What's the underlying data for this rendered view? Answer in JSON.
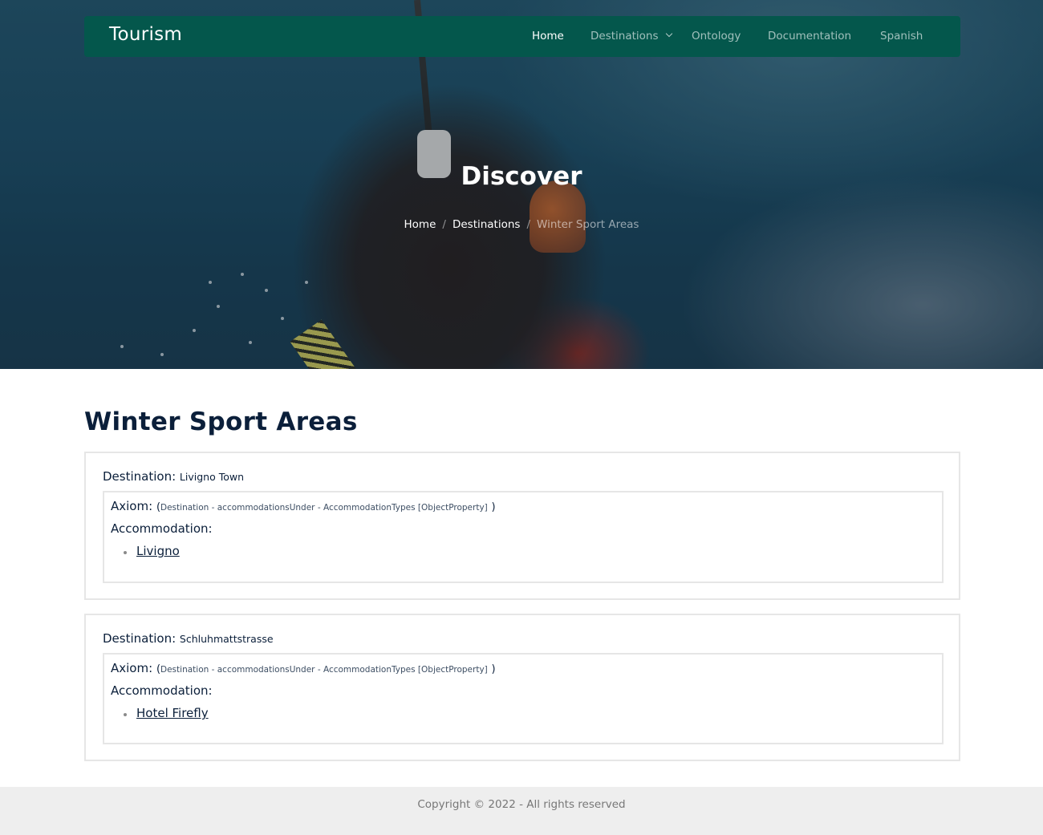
{
  "header": {
    "brand": "Tourism",
    "nav": [
      {
        "label": "Home"
      },
      {
        "label": "Destinations"
      },
      {
        "label": "Ontology"
      },
      {
        "label": "Documentation"
      },
      {
        "label": "Spanish"
      }
    ],
    "active": "Home",
    "background_color": "#04574c"
  },
  "hero": {
    "title": "Discover",
    "breadcrumb": [
      "Home",
      "Destinations",
      "Winter Sport Areas"
    ],
    "separator": "/"
  },
  "main": {
    "title": "Winter Sport Areas",
    "destinations": [
      {
        "label": "Destination:",
        "name": "Livigno Town",
        "axiom_label": "Axiom:",
        "axiom_open": "(",
        "axiom_text": "Destination - accommodationsUnder - AccommodationTypes [ObjectProperty]",
        "axiom_close": ")",
        "accommodation_label": "Accommodation:",
        "accommodations": [
          "Livigno"
        ]
      },
      {
        "label": "Destination:",
        "name": "Schluhmattstrasse",
        "axiom_label": "Axiom:",
        "axiom_open": "(",
        "axiom_text": "Destination - accommodationsUnder - AccommodationTypes [ObjectProperty]",
        "axiom_close": ")",
        "accommodation_label": "Accommodation:",
        "accommodations": [
          "Hotel Firefly"
        ]
      }
    ]
  },
  "footer": {
    "text": "Copyright © 2022 - All rights reserved"
  }
}
